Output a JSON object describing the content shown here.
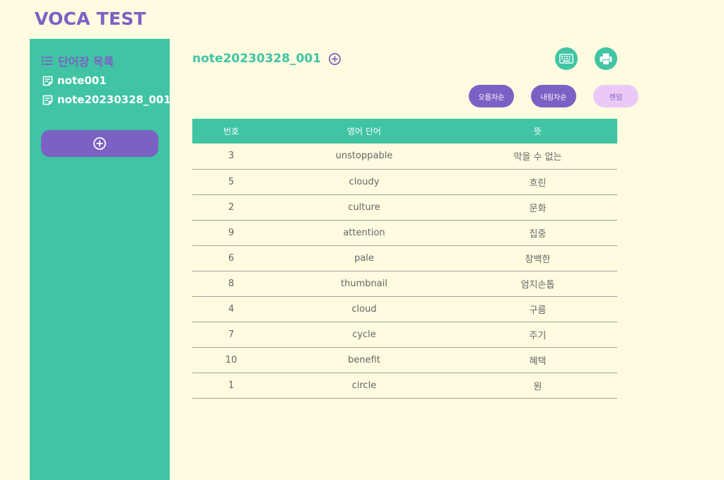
{
  "app": {
    "title": "VOCA TEST"
  },
  "sidebar": {
    "header": "단어장 목록",
    "items": [
      {
        "label": "note001"
      },
      {
        "label": "note20230328_001"
      }
    ]
  },
  "main": {
    "title": "note20230328_001",
    "sort_buttons": {
      "asc": "오름차순",
      "desc": "내림차순",
      "random": "랜덤"
    },
    "table": {
      "headers": [
        "번호",
        "영어 단어",
        "뜻"
      ],
      "rows": [
        [
          "3",
          "unstoppable",
          "막을 수 없는"
        ],
        [
          "5",
          "cloudy",
          "흐린"
        ],
        [
          "2",
          "culture",
          "문화"
        ],
        [
          "9",
          "attention",
          "집중"
        ],
        [
          "6",
          "pale",
          "창백한"
        ],
        [
          "8",
          "thumbnail",
          "엄지손톱"
        ],
        [
          "4",
          "cloud",
          "구름"
        ],
        [
          "7",
          "cycle",
          "주기"
        ],
        [
          "10",
          "benefit",
          "혜택"
        ],
        [
          "1",
          "circle",
          "원"
        ]
      ]
    }
  },
  "icons": {
    "header": "list-icon",
    "item": "note-icon",
    "add": "plus-circle-icon",
    "keyboard": "keyboard-icon",
    "print": "printer-icon"
  },
  "colors": {
    "background": "#fefbe0",
    "accent_green": "#40c4a4",
    "accent_purple": "#7b61c4",
    "random_button": "#ebc9f6"
  }
}
